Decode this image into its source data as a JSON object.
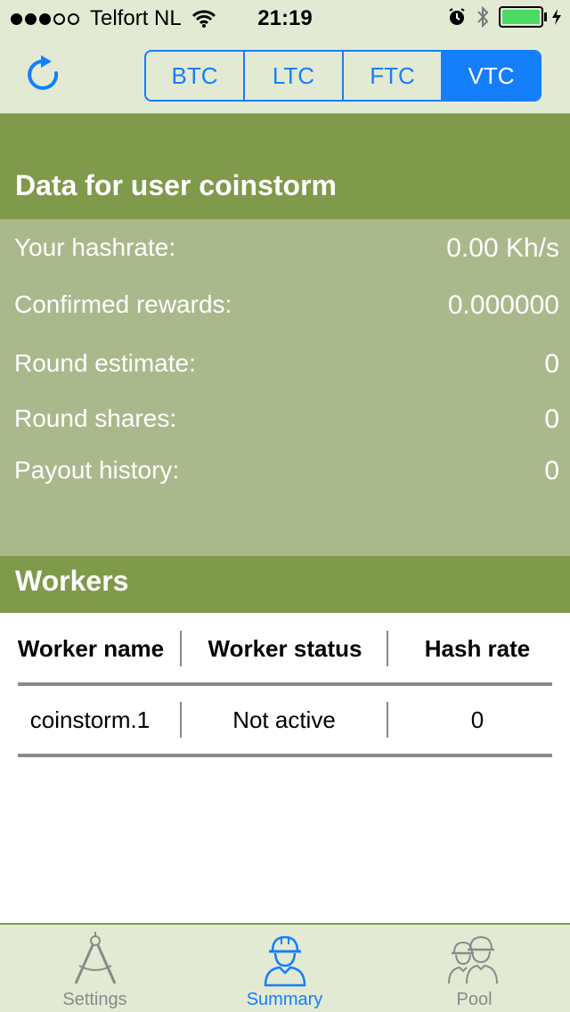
{
  "status_bar": {
    "carrier": "Telfort NL",
    "time": "21:19",
    "signal_bars_filled": 3,
    "signal_bars_total": 5
  },
  "nav": {
    "coins": [
      "BTC",
      "LTC",
      "FTC",
      "VTC"
    ],
    "selected_coin": "VTC"
  },
  "user_section": {
    "title": "Data for user coinstorm",
    "rows": [
      {
        "label": "Your hashrate:",
        "value": "0.00 Kh/s"
      },
      {
        "label": "Confirmed rewards:",
        "value": "0.000000"
      },
      {
        "label": "Round estimate:",
        "value": "0"
      },
      {
        "label": "Round shares:",
        "value": "0"
      },
      {
        "label": "Payout history:",
        "value": "0"
      }
    ]
  },
  "workers": {
    "title": "Workers",
    "columns": [
      "Worker name",
      "Worker status",
      "Hash rate"
    ],
    "rows": [
      {
        "name": "coinstorm.1",
        "status": "Not active",
        "rate": "0"
      }
    ]
  },
  "tabbar": {
    "items": [
      "Settings",
      "Summary",
      "Pool"
    ],
    "active": "Summary"
  },
  "colors": {
    "accent": "#157efb",
    "band": "#7f9a4a",
    "panel": "#aab98c",
    "bar_bg": "#e3ead3"
  }
}
